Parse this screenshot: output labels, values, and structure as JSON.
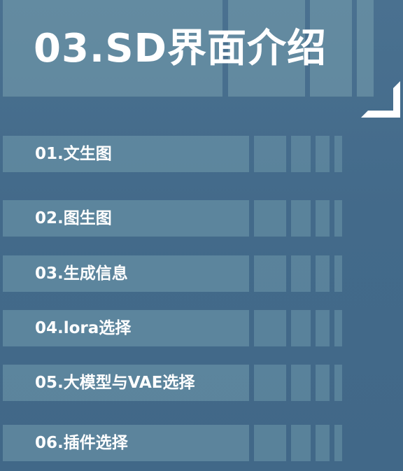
{
  "title": "03.SD界面介绍",
  "menu": [
    {
      "label": "01.文生图"
    },
    {
      "label": "02.图生图"
    },
    {
      "label": "03.生成信息"
    },
    {
      "label": "04.lora选择"
    },
    {
      "label": "05.大模型与VAE选择"
    },
    {
      "label": "06.插件选择"
    }
  ],
  "colors": {
    "background": "#446b8a",
    "panel": "#7aa0b0",
    "text": "#ffffff"
  }
}
